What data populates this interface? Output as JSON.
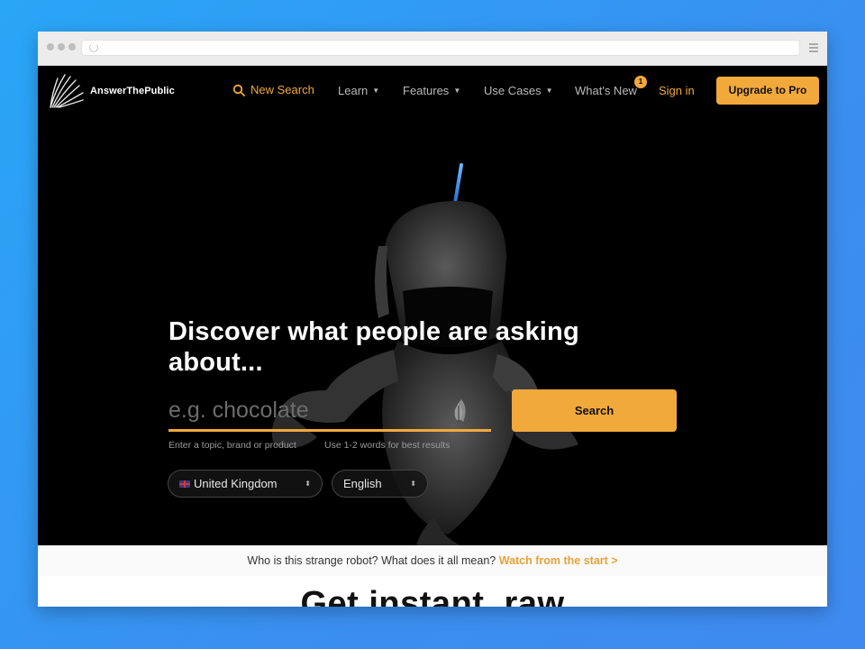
{
  "browser": {
    "url": ""
  },
  "brand": {
    "name": "AnswerThePublic"
  },
  "nav": {
    "new_search": "New Search",
    "learn": "Learn",
    "features": "Features",
    "use_cases": "Use Cases",
    "whats_new": "What's New",
    "whats_new_badge": "1",
    "sign_in": "Sign in",
    "upgrade": "Upgrade to Pro"
  },
  "hero": {
    "headline": "Discover what people are asking about...",
    "search_placeholder": "e.g. chocolate",
    "search_button": "Search",
    "hint_topic": "Enter a topic, brand or product",
    "hint_words": "Use 1-2 words for best results",
    "country": "United Kingdom",
    "language": "English"
  },
  "strip": {
    "text": "Who is this strange robot? What does it all mean?",
    "link": "Watch from the start >"
  },
  "section": {
    "title": "Get instant, raw"
  },
  "colors": {
    "accent": "#f2a93b",
    "background": "#000000"
  },
  "icons": [
    "reload-icon",
    "menu-icon",
    "logo-icon",
    "search-icon",
    "chevron-down-icon",
    "leaf-icon",
    "flag-icon",
    "updown-icon"
  ]
}
